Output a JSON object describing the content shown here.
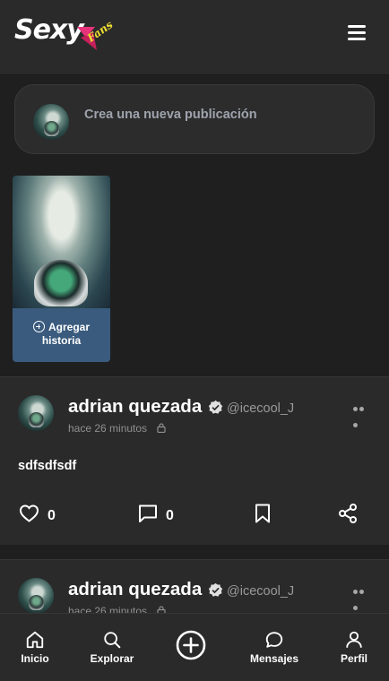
{
  "brand": {
    "name": "Sexy",
    "suffix": "Fans",
    "accent": "#e8327a",
    "suffix_color": "#f0e030"
  },
  "composer": {
    "placeholder": "Crea una nueva publicación"
  },
  "story": {
    "add_label": "Agregar historia",
    "bar_color": "#3a5b7d"
  },
  "posts": [
    {
      "name": "adrian quezada",
      "handle": "@icecool_J",
      "time": "hace 26 minutos",
      "body": "sdfsdfsdf",
      "likes": "0",
      "comments": "0"
    },
    {
      "name": "adrian quezada",
      "handle": "@icecool_J",
      "time": "hace 26 minutos"
    }
  ],
  "nav": {
    "items": [
      {
        "label": "Inicio",
        "icon": "home-icon"
      },
      {
        "label": "Explorar",
        "icon": "search-icon"
      },
      {
        "label": "",
        "icon": "plus-circle-icon"
      },
      {
        "label": "Mensajes",
        "icon": "chat-icon"
      },
      {
        "label": "Perfil",
        "icon": "user-icon"
      }
    ]
  }
}
